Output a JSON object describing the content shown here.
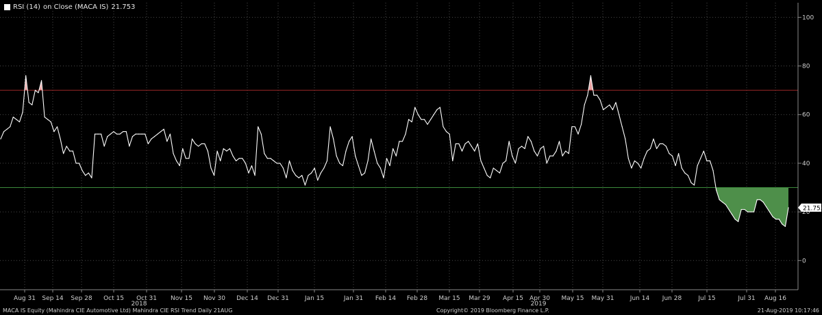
{
  "legend": {
    "name": "RSI (14)",
    "source": "on Close (MACA IS)",
    "last": "21.753"
  },
  "footer": {
    "left": "MACA IS Equity (Mahindra CIE Automotive Ltd) Mahindra CIE RSI Trend  Daily 21AUG",
    "center": "Copyright© 2019 Bloomberg Finance L.P.",
    "right": "21-Aug-2019 10:17:46"
  },
  "colors": {
    "background": "#000000",
    "line": "#ffffff",
    "overbought": "#a02828",
    "oversold": "#3c8a3c",
    "oversold_fill": "#4e8f4a",
    "overbought_fill": "#e8a0a0",
    "grid": "#4a4a4a"
  },
  "chart_data": {
    "type": "line",
    "title": "",
    "ylim": [
      -12,
      106
    ],
    "y_ticks": [
      0,
      20,
      40,
      60,
      80,
      100
    ],
    "overbought_level": 70,
    "oversold_level": 30,
    "last_value": 21.753,
    "last_value_label": "21.753",
    "x_ticks": [
      "Aug 31",
      "Sep 14",
      "Sep 28",
      "Oct 15",
      "Oct 31",
      "Nov 15",
      "Nov 30",
      "Dec 14",
      "Dec 31",
      "Jan 15",
      "Jan 31",
      "Feb 14",
      "Feb 28",
      "Mar 15",
      "Mar 29",
      "Apr 15",
      "Apr 30",
      "May 15",
      "May 31",
      "Jun 14",
      "Jun 28",
      "Jul 15",
      "Jul 31",
      "Aug 16"
    ],
    "year_labels": [
      {
        "label": "2018",
        "under": "Oct 31"
      },
      {
        "label": "2019",
        "under": "Apr 30"
      }
    ],
    "series": [
      {
        "values": [
          50,
          53,
          54,
          55,
          59,
          58,
          57,
          61,
          76,
          65,
          64,
          70,
          69,
          74,
          59,
          58,
          57,
          53,
          55,
          50,
          44,
          47,
          45,
          45,
          40,
          40,
          37,
          35,
          36,
          34,
          52,
          52,
          52,
          47,
          51,
          52,
          53,
          52,
          52,
          53,
          53,
          47,
          51,
          52,
          52,
          52,
          52,
          48,
          50,
          51,
          52,
          53,
          54,
          49,
          52,
          44,
          41,
          39,
          46,
          42,
          42,
          50,
          48,
          47,
          48,
          48,
          45,
          38,
          35,
          45,
          41,
          46,
          45,
          46,
          43,
          41,
          42,
          42,
          40,
          36,
          39,
          35,
          55,
          52,
          44,
          42,
          42,
          41,
          40,
          40,
          38,
          34,
          41,
          37,
          35,
          34,
          35,
          31,
          35,
          36,
          38,
          33,
          36,
          38,
          41,
          55,
          50,
          43,
          40,
          39,
          45,
          49,
          51,
          43,
          39,
          35,
          36,
          41,
          50,
          45,
          40,
          38,
          34,
          42,
          39,
          46,
          43,
          49,
          49,
          52,
          58,
          57,
          63,
          60,
          58,
          58,
          56,
          58,
          60,
          62,
          63,
          55,
          53,
          52,
          41,
          48,
          48,
          45,
          48,
          49,
          47,
          45,
          48,
          41,
          38,
          35,
          34,
          38,
          37,
          36,
          40,
          41,
          49,
          43,
          40,
          46,
          47,
          46,
          51,
          49,
          45,
          43,
          46,
          47,
          40,
          43,
          43,
          45,
          49,
          43,
          45,
          44,
          55,
          55,
          52,
          56,
          64,
          68,
          76,
          68,
          68,
          66,
          62,
          63,
          64,
          62,
          65,
          60,
          55,
          50,
          42,
          38,
          41,
          40,
          38,
          42,
          45,
          46,
          50,
          46,
          48,
          48,
          47,
          44,
          43,
          39,
          44,
          38,
          36,
          35,
          32,
          31,
          39,
          42,
          45,
          41,
          41,
          37,
          29,
          25,
          24,
          23,
          21,
          19,
          17,
          16,
          21,
          21,
          20,
          20,
          20,
          25,
          25,
          24,
          22,
          20,
          18,
          17,
          17,
          15,
          14,
          21.753
        ]
      }
    ]
  }
}
